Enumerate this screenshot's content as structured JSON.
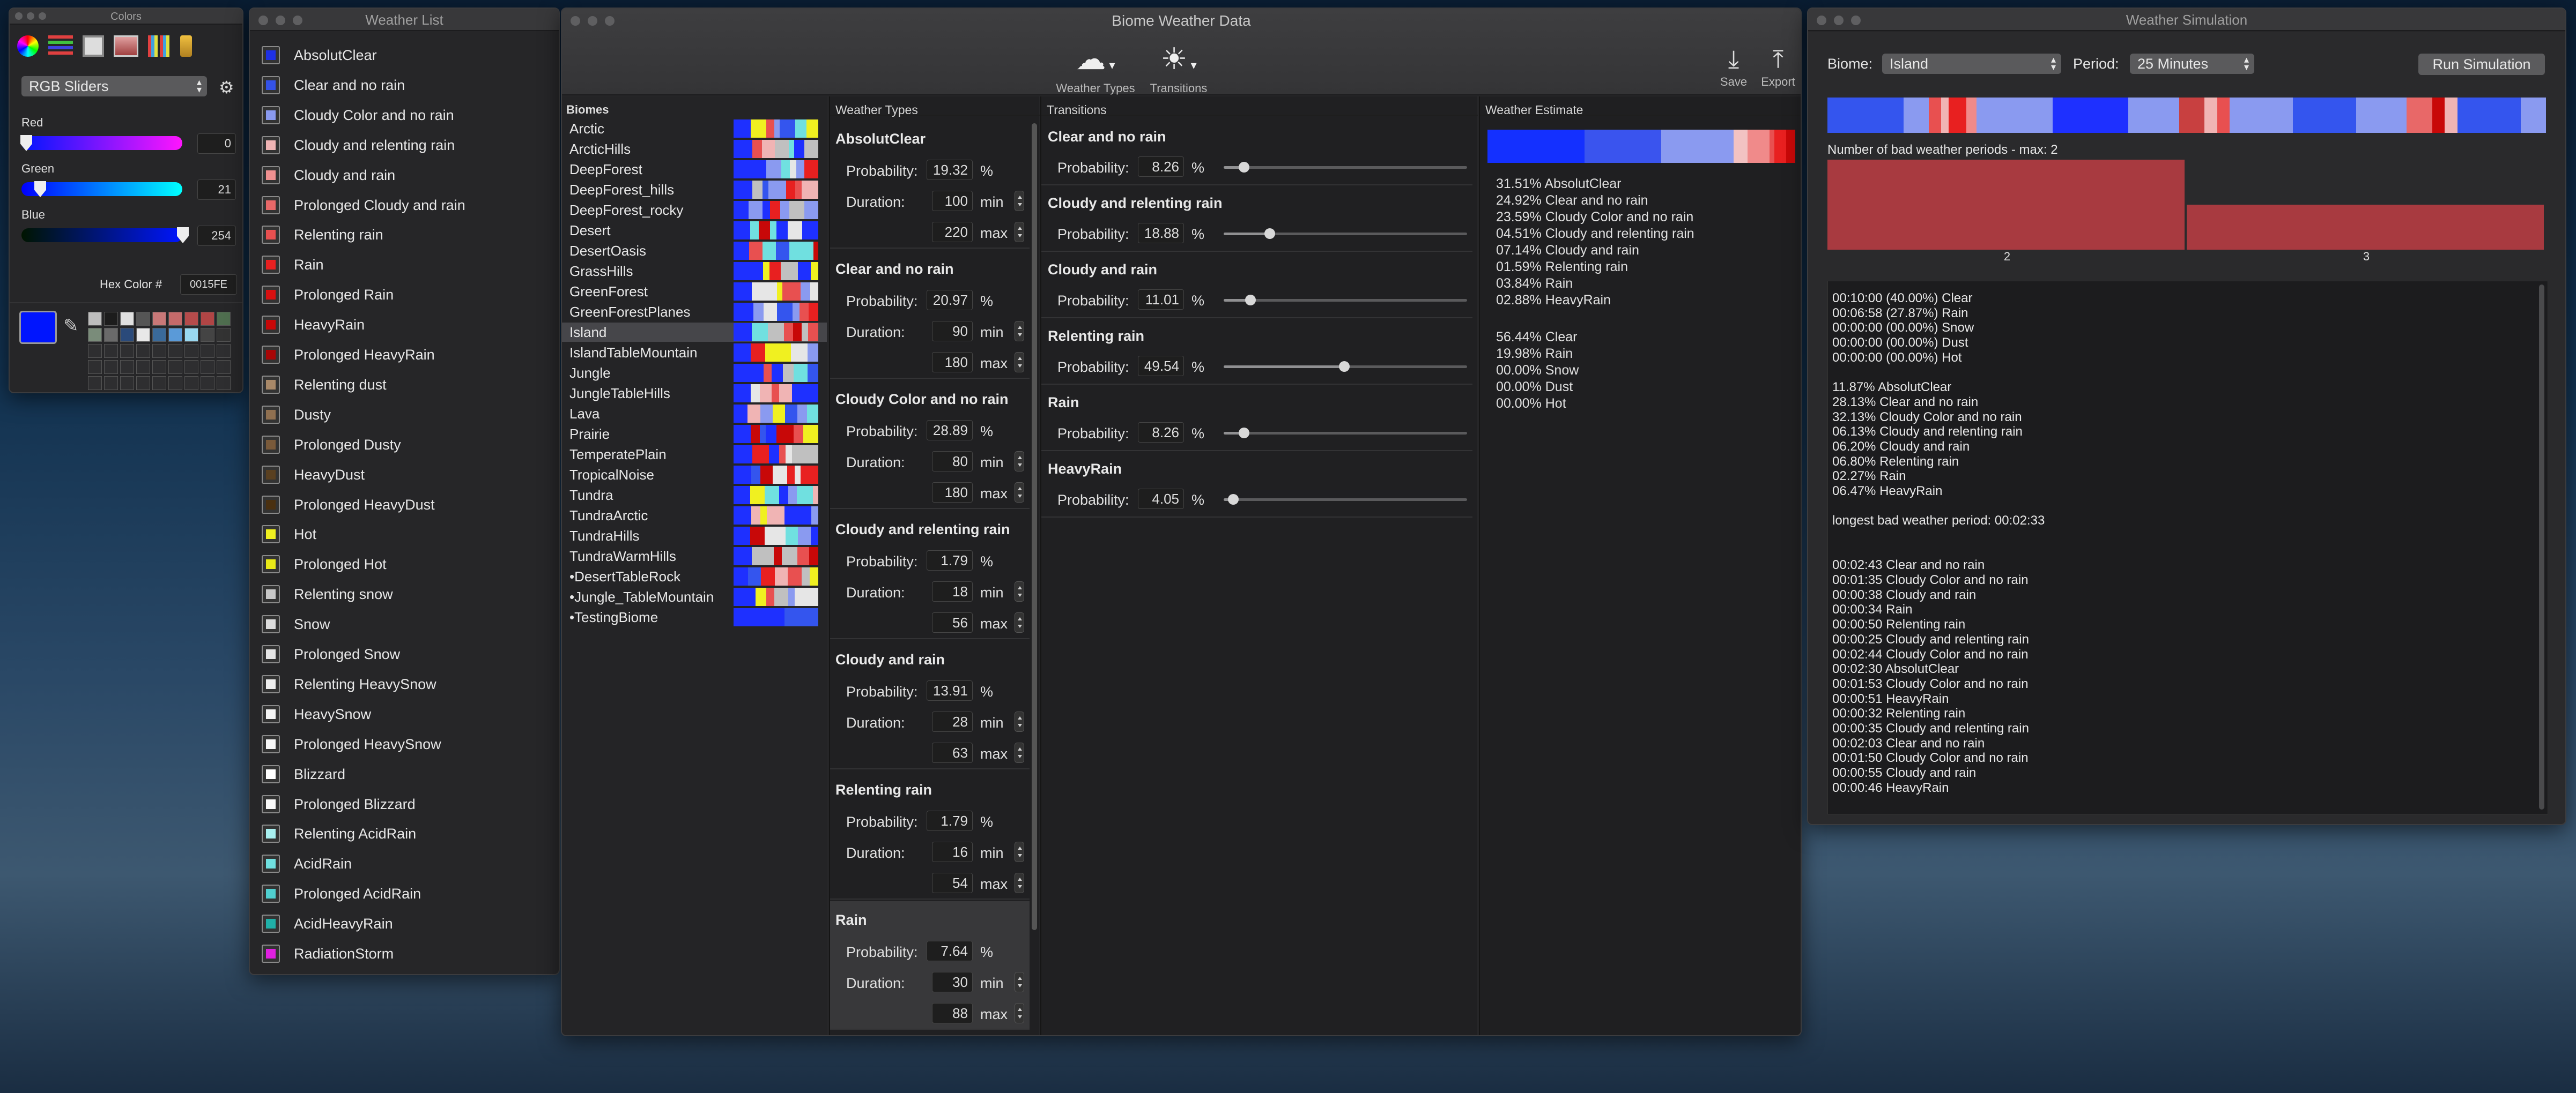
{
  "colors_win": {
    "title": "Colors",
    "mode": "RGB Sliders",
    "red_label": "Red",
    "red_val": "0",
    "green_label": "Green",
    "green_val": "21",
    "blue_label": "Blue",
    "blue_val": "254",
    "hex_label": "Hex Color #",
    "hex_val": "0015FE",
    "current_color": "#0015FE",
    "palette": [
      "#bdbdbd",
      "#1c1c1c",
      "#e0e0e0",
      "#555",
      "#c87878",
      "#c46a6a",
      "#b54b4b",
      "#b04545",
      "#4f6e4f",
      "#7a8c7a",
      "#6a6a6a",
      "#2a4a7a",
      "#e8e8e8",
      "#3a6a9a",
      "#5a9ad8",
      "#9ad8f0",
      "#444",
      "#333"
    ]
  },
  "weather_list": {
    "title": "Weather List",
    "items": [
      {
        "label": "AbsolutClear",
        "color": "#1e30e6"
      },
      {
        "label": "Clear and no rain",
        "color": "#3452e8"
      },
      {
        "label": "Cloudy Color and no rain",
        "color": "#8a9af0"
      },
      {
        "label": "Cloudy and relenting rain",
        "color": "#f0b4b4"
      },
      {
        "label": "Cloudy and rain",
        "color": "#f09090"
      },
      {
        "label": "Prolonged Cloudy and rain",
        "color": "#e86868"
      },
      {
        "label": "Relenting rain",
        "color": "#e85050"
      },
      {
        "label": "Rain",
        "color": "#e82020"
      },
      {
        "label": "Prolonged Rain",
        "color": "#d81010"
      },
      {
        "label": "HeavyRain",
        "color": "#c80808"
      },
      {
        "label": "Prolonged HeavyRain",
        "color": "#a80606"
      },
      {
        "label": "Relenting dust",
        "color": "#a88868"
      },
      {
        "label": "Dusty",
        "color": "#907050"
      },
      {
        "label": "Prolonged Dusty",
        "color": "#7a5a3a"
      },
      {
        "label": "HeavyDust",
        "color": "#5a4020"
      },
      {
        "label": "Prolonged HeavyDust",
        "color": "#4a3010"
      },
      {
        "label": "Hot",
        "color": "#f0f020"
      },
      {
        "label": "Prolonged Hot",
        "color": "#e8e818"
      },
      {
        "label": "Relenting snow",
        "color": "#c8c8c8"
      },
      {
        "label": "Snow",
        "color": "#dcdcdc"
      },
      {
        "label": "Prolonged Snow",
        "color": "#e6e6e6"
      },
      {
        "label": "Relenting HeavySnow",
        "color": "#eeeeee"
      },
      {
        "label": "HeavySnow",
        "color": "#f4f4f4"
      },
      {
        "label": "Prolonged HeavySnow",
        "color": "#f8f8f8"
      },
      {
        "label": "Blizzard",
        "color": "#ffffff"
      },
      {
        "label": "Prolonged Blizzard",
        "color": "#fafafa"
      },
      {
        "label": "Relenting AcidRain",
        "color": "#a8f0f0"
      },
      {
        "label": "AcidRain",
        "color": "#70e0e0"
      },
      {
        "label": "Prolonged AcidRain",
        "color": "#50d0d0"
      },
      {
        "label": "AcidHeavyRain",
        "color": "#20b0a8"
      },
      {
        "label": "RadiationStorm",
        "color": "#e020e0"
      }
    ]
  },
  "biome_win": {
    "title": "Biome Weather Data",
    "toolbar": {
      "weather_types": "Weather Types",
      "transitions": "Transitions",
      "save": "Save",
      "export": "Export"
    },
    "col_headers": {
      "biomes": "Biomes",
      "weather_types": "Weather Types",
      "transitions": "Transitions",
      "estimate": "Weather Estimate"
    },
    "biomes": [
      "Arctic",
      "ArcticHills",
      "DeepForest",
      "DeepForest_hills",
      "DeepForest_rocky",
      "Desert",
      "DesertOasis",
      "GrassHills",
      "GreenForest",
      "GreenForestPlanes",
      "Island",
      "IslandTableMountain",
      "Jungle",
      "JungleTableHills",
      "Lava",
      "Prairie",
      "TemperatePlain",
      "TropicalNoise",
      "Tundra",
      "TundraArctic",
      "TundraHills",
      "TundraWarmHills",
      "•DesertTableRock",
      "•Jungle_TableMountain",
      "•TestingBiome"
    ],
    "selected_biome": "Island",
    "labels": {
      "probability": "Probability:",
      "duration": "Duration:",
      "pct": "%",
      "min": "min",
      "max": "max"
    },
    "weather_types": [
      {
        "name": "AbsolutClear",
        "prob": "19.32",
        "dur": "100",
        "max": "220"
      },
      {
        "name": "Clear and no rain",
        "prob": "20.97",
        "dur": "90",
        "max": "180"
      },
      {
        "name": "Cloudy Color and no rain",
        "prob": "28.89",
        "dur": "80",
        "max": "180"
      },
      {
        "name": "Cloudy and relenting rain",
        "prob": "1.79",
        "dur": "18",
        "max": "56"
      },
      {
        "name": "Cloudy and rain",
        "prob": "13.91",
        "dur": "28",
        "max": "63"
      },
      {
        "name": "Relenting rain",
        "prob": "1.79",
        "dur": "16",
        "max": "54"
      },
      {
        "name": "Rain",
        "prob": "7.64",
        "dur": "30",
        "max": "88"
      }
    ],
    "transitions": [
      {
        "name": "Clear and no rain",
        "prob": "8.26",
        "level": 0.0826
      },
      {
        "name": "Cloudy and relenting rain",
        "prob": "18.88",
        "level": 0.1888
      },
      {
        "name": "Cloudy and rain",
        "prob": "11.01",
        "level": 0.1101
      },
      {
        "name": "Relenting rain",
        "prob": "49.54",
        "level": 0.4954
      },
      {
        "name": "Rain",
        "prob": "8.26",
        "level": 0.0826
      },
      {
        "name": "HeavyRain",
        "prob": "4.05",
        "level": 0.0405
      }
    ],
    "estimate_lines1": [
      "31.51% AbsolutClear",
      "24.92% Clear and no rain",
      "23.59% Cloudy Color and no rain",
      "04.51% Cloudy and relenting rain",
      "07.14% Cloudy and rain",
      "01.59% Relenting rain",
      "03.84% Rain",
      "02.88% HeavyRain"
    ],
    "estimate_lines2": [
      "56.44% Clear",
      "19.98% Rain",
      "00.00% Snow",
      "00.00% Dust",
      "00.00% Hot"
    ],
    "estimate_bar": [
      {
        "c": "#1430ff",
        "w": 31.51
      },
      {
        "c": "#3a54ee",
        "w": 24.92
      },
      {
        "c": "#8a9af0",
        "w": 23.59
      },
      {
        "c": "#f2c2c2",
        "w": 4.51
      },
      {
        "c": "#f08a8a",
        "w": 7.14
      },
      {
        "c": "#e85050",
        "w": 1.59
      },
      {
        "c": "#e82020",
        "w": 3.84
      },
      {
        "c": "#c80808",
        "w": 2.88
      }
    ]
  },
  "sim_win": {
    "title": "Weather Simulation",
    "biome_label": "Biome:",
    "biome_val": "Island",
    "period_label": "Period:",
    "period_val": "25 Minutes",
    "run": "Run Simulation",
    "bad_title": "Number of bad weather periods - max: 2",
    "histogram": {
      "categories": [
        "2",
        "3"
      ],
      "values": [
        2,
        1
      ],
      "ymax": 2
    },
    "timeline": [
      {
        "c": "#3455ee",
        "w": 6
      },
      {
        "c": "#8a9af0",
        "w": 2
      },
      {
        "c": "#e85050",
        "w": 1
      },
      {
        "c": "#f0b4b4",
        "w": 0.6
      },
      {
        "c": "#e82020",
        "w": 1.4
      },
      {
        "c": "#f08a8a",
        "w": 0.8
      },
      {
        "c": "#8a9af0",
        "w": 6
      },
      {
        "c": "#1e30ff",
        "w": 6
      },
      {
        "c": "#8a9af0",
        "w": 4
      },
      {
        "c": "#c84040",
        "w": 2
      },
      {
        "c": "#f0b4b4",
        "w": 1
      },
      {
        "c": "#e85050",
        "w": 1
      },
      {
        "c": "#8a9af0",
        "w": 5
      },
      {
        "c": "#3455ee",
        "w": 5
      },
      {
        "c": "#8a9af0",
        "w": 4
      },
      {
        "c": "#e86868",
        "w": 2
      },
      {
        "c": "#c80808",
        "w": 1
      },
      {
        "c": "#f0b4b4",
        "w": 1
      },
      {
        "c": "#3455ee",
        "w": 5
      },
      {
        "c": "#8a9af0",
        "w": 2
      }
    ],
    "log": [
      "00:10:00 (40.00%) Clear",
      "00:06:58 (27.87%) Rain",
      "00:00:00 (00.00%) Snow",
      "00:00:00 (00.00%) Dust",
      "00:00:00 (00.00%) Hot",
      "",
      "11.87% AbsolutClear",
      "28.13% Clear and no rain",
      "32.13% Cloudy Color and no rain",
      "06.13% Cloudy and relenting rain",
      "06.20% Cloudy and rain",
      "06.80% Relenting rain",
      "02.27% Rain",
      "06.47% HeavyRain",
      "",
      "longest bad weather period: 00:02:33",
      "",
      "",
      "00:02:43  Clear and no rain",
      "00:01:35  Cloudy Color and no rain",
      "00:00:38  Cloudy and rain",
      "00:00:34  Rain",
      "00:00:50  Relenting rain",
      "00:00:25  Cloudy and relenting rain",
      "00:02:44  Cloudy Color and no rain",
      "00:02:30  AbsolutClear",
      "00:01:53  Cloudy Color and no rain",
      "00:00:51  HeavyRain",
      "00:00:32  Relenting rain",
      "00:00:35  Cloudy and relenting rain",
      "00:02:03  Clear and no rain",
      "00:01:50  Cloudy Color and no rain",
      "00:00:55  Cloudy and rain",
      "00:00:46  HeavyRain"
    ]
  }
}
